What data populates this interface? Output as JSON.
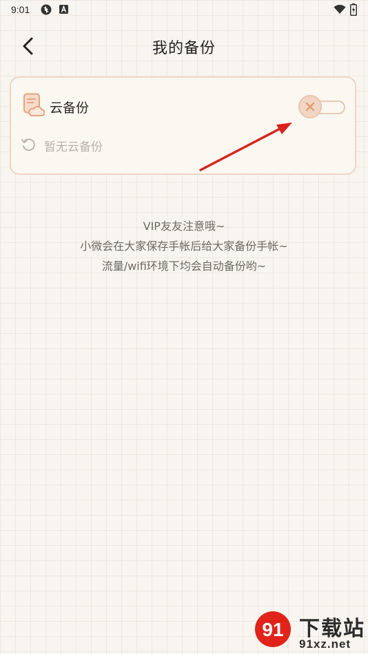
{
  "status_bar": {
    "time": "9:01",
    "icons": [
      "sync-icon",
      "a-badge-icon",
      "wifi-icon",
      "battery-icon"
    ]
  },
  "header": {
    "back_icon": "chevron-left-icon",
    "title": "我的备份"
  },
  "backup_card": {
    "icon": "cloud-document-icon",
    "label": "云备份",
    "toggle_on": false,
    "status_icon": "refresh-icon",
    "status_text": "暂无云备份"
  },
  "notice": {
    "lines": [
      "VIP友友注意哦~",
      "小微会在大家保存手帐后给大家备份手帐~",
      "流量/wifi环境下均会自动备份哟~"
    ]
  },
  "watermark": {
    "text": "下载站",
    "url": "91xz.net"
  },
  "colors": {
    "background": "#f8f5f0",
    "card_border": "#f2d5c3",
    "accent": "#e9a27a",
    "muted_text": "#b9b2ab",
    "annotation_arrow": "#d8241c"
  }
}
